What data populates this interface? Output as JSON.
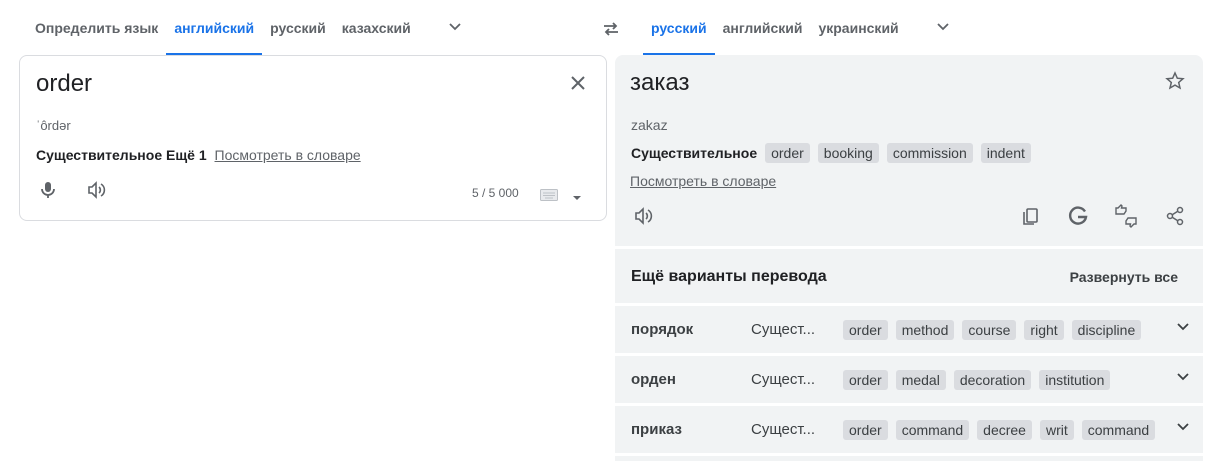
{
  "source_langs": {
    "tabs": [
      "Определить язык",
      "английский",
      "русский",
      "казахский"
    ],
    "active_index": 1
  },
  "target_langs": {
    "tabs": [
      "русский",
      "английский",
      "украинский"
    ],
    "active_index": 0
  },
  "source": {
    "text": "order",
    "phonetic": "ˈôrdər",
    "pos_label": "Существительное",
    "more_label": "Ещё 1",
    "dict_link": "Посмотреть в словаре",
    "char_count": "5 / 5 000"
  },
  "target": {
    "text": "заказ",
    "transliteration": "zakaz",
    "pos_label": "Существительное",
    "synonyms": [
      "order",
      "booking",
      "commission",
      "indent"
    ],
    "dict_link": "Посмотреть в словаре"
  },
  "more_translations": {
    "title": "Ещё варианты перевода",
    "expand_all": "Развернуть все",
    "rows": [
      {
        "word": "порядок",
        "pos": "Сущест...",
        "synonyms": [
          "order",
          "method",
          "course",
          "right",
          "discipline"
        ]
      },
      {
        "word": "орден",
        "pos": "Сущест...",
        "synonyms": [
          "order",
          "medal",
          "decoration",
          "institution"
        ]
      },
      {
        "word": "приказ",
        "pos": "Сущест...",
        "synonyms": [
          "order",
          "command",
          "decree",
          "writ",
          "command"
        ]
      }
    ]
  },
  "colors": {
    "accent": "#1a73e8",
    "panel": "#f1f3f4",
    "chip": "#dadce0",
    "text": "#202124",
    "muted": "#5f6368"
  }
}
